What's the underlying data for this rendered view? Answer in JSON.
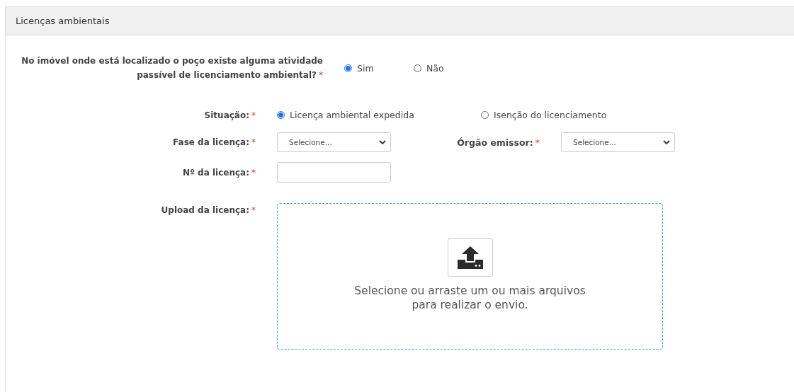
{
  "panel": {
    "title": "Licenças ambientais"
  },
  "question": {
    "lines": [
      "No imóvel onde está localizado o poço existe alguma atividade",
      "passível de licenciamento ambiental?"
    ],
    "mark": "*",
    "options": [
      {
        "label": "Sim",
        "selected": true
      },
      {
        "label": "Não",
        "selected": false
      }
    ]
  },
  "situacao": {
    "label": "Situação:",
    "mark": "*",
    "options": [
      {
        "label": "Licença ambiental expedida",
        "selected": true
      },
      {
        "label": "Isenção do licenciamento",
        "selected": false
      }
    ]
  },
  "fase": {
    "label": "Fase da licença:",
    "mark": "*",
    "placeholder": "Selecione..."
  },
  "orgao": {
    "label": "Órgão emissor:",
    "mark": "*",
    "placeholder": "Selecione..."
  },
  "numero": {
    "label": "Nº da licença:",
    "mark": "*"
  },
  "upload": {
    "label": "Upload da licença:",
    "mark": "*",
    "lines": [
      "Selecione ou arraste um ou mais arquivos",
      "para realizar o envio."
    ]
  }
}
